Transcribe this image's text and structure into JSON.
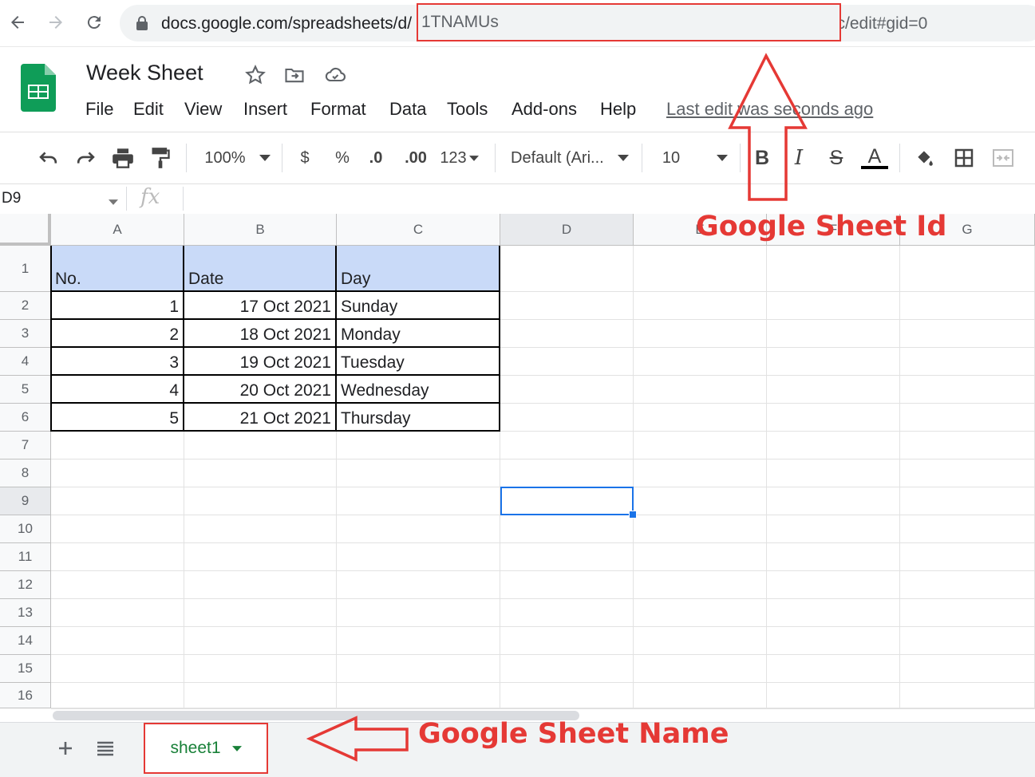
{
  "browser": {
    "url_visible_start": "docs.google.com/spreadsheets/d/",
    "url_id_visible": "1TNAMUs",
    "url_visible_end": "Wxhxc/edit#gid=0"
  },
  "doc": {
    "title": "Week Sheet",
    "menu": [
      "File",
      "Edit",
      "View",
      "Insert",
      "Format",
      "Data",
      "Tools",
      "Add-ons",
      "Help"
    ],
    "last_edit": "Last edit was seconds ago"
  },
  "toolbar": {
    "zoom": "100%",
    "currency": "$",
    "percent": "%",
    "dec_decrease": ".0",
    "dec_increase": ".00",
    "more_formats": "123",
    "font": "Default (Ari...",
    "font_size": "10",
    "bold": "B",
    "italic": "I",
    "strike": "S",
    "text_color": "A"
  },
  "formula": {
    "namebox": "D9",
    "fx": "fx"
  },
  "grid": {
    "columns": [
      "A",
      "B",
      "C",
      "D",
      "E",
      "F",
      "G"
    ],
    "selected_column": "D",
    "rows": [
      "1",
      "2",
      "3",
      "4",
      "5",
      "6",
      "7",
      "8",
      "9",
      "10",
      "11",
      "12",
      "13",
      "14",
      "15",
      "16"
    ],
    "selected_row": "9",
    "headers": [
      "No.",
      "Date",
      "Day"
    ],
    "data": [
      [
        "1",
        "17 Oct 2021",
        "Sunday"
      ],
      [
        "2",
        "18 Oct 2021",
        "Monday"
      ],
      [
        "3",
        "19 Oct 2021",
        "Tuesday"
      ],
      [
        "4",
        "20 Oct 2021",
        "Wednesday"
      ],
      [
        "5",
        "21 Oct 2021",
        "Thursday"
      ]
    ]
  },
  "sheets": {
    "active": "sheet1"
  },
  "annotations": {
    "sheet_id": "Google Sheet Id",
    "sheet_name": "Google Sheet Name"
  },
  "colors": {
    "annotation_red": "#e53935",
    "header_fill": "#c9daf8",
    "selection_blue": "#1a73e8",
    "sheets_green": "#188038"
  }
}
